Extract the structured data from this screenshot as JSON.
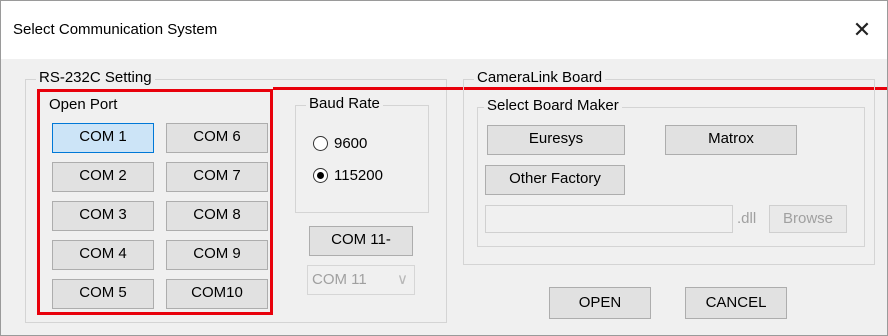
{
  "window": {
    "title": "Select Communication System",
    "close_glyph": "✕"
  },
  "rs232": {
    "legend": "RS-232C Setting",
    "open_port": {
      "legend": "Open Port",
      "ports": [
        "COM 1",
        "COM 6",
        "COM 2",
        "COM 7",
        "COM 3",
        "COM 8",
        "COM 4",
        "COM 9",
        "COM 5",
        "COM10"
      ],
      "selected": "COM 1"
    },
    "baud": {
      "legend": "Baud Rate",
      "options": [
        "9600",
        "115200"
      ],
      "selected": "115200"
    },
    "com11_button": "COM 11-",
    "com11_combo": {
      "value": "COM 11",
      "chevron": "∨"
    }
  },
  "cameralink": {
    "legend": "CameraLink Board",
    "maker": {
      "legend": "Select Board Maker",
      "buttons": [
        "Euresys",
        "Matrox",
        "Other Factory"
      ]
    },
    "dll_path": {
      "value": "",
      "suffix": ".dll",
      "browse_label": "Browse"
    }
  },
  "actions": {
    "open_label": "OPEN",
    "cancel_label": "CANCEL"
  },
  "colors": {
    "highlight": "#e8000b",
    "selected_button": "#cce4f7",
    "selected_border": "#0078d7"
  }
}
